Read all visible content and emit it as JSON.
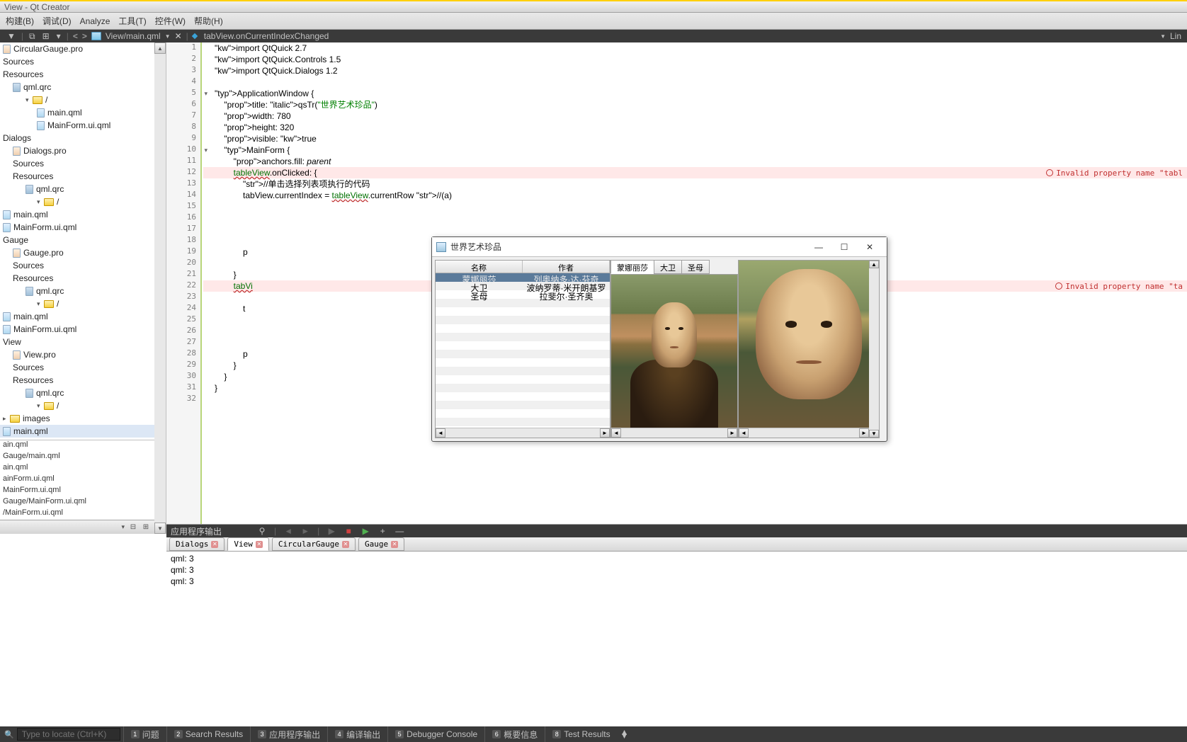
{
  "title_bar": "View - Qt Creator",
  "menu": [
    "构建(B)",
    "调试(D)",
    "Analyze",
    "工具(T)",
    "控件(W)",
    "帮助(H)"
  ],
  "toolbar": {
    "nav": [
      "<",
      ">"
    ],
    "file": "View/main.qml",
    "func": "tabView.onCurrentIndexChanged",
    "right": "Lin"
  },
  "tree": [
    {
      "lvl": 0,
      "type": "pro",
      "label": "CircularGauge.pro"
    },
    {
      "lvl": 0,
      "type": "section",
      "label": "Sources"
    },
    {
      "lvl": 0,
      "type": "section",
      "label": "Resources"
    },
    {
      "lvl": 1,
      "type": "qrc",
      "label": "qml.qrc"
    },
    {
      "lvl": 2,
      "type": "folder",
      "caret": "v",
      "label": "/"
    },
    {
      "lvl": 3,
      "type": "qml",
      "label": "main.qml"
    },
    {
      "lvl": 3,
      "type": "qml",
      "label": "MainForm.ui.qml"
    },
    {
      "lvl": 0,
      "type": "section",
      "label": "Dialogs"
    },
    {
      "lvl": 1,
      "type": "pro",
      "label": "Dialogs.pro"
    },
    {
      "lvl": 1,
      "type": "section",
      "label": "Sources"
    },
    {
      "lvl": 1,
      "type": "section",
      "label": "Resources"
    },
    {
      "lvl": 2,
      "type": "qrc",
      "label": "qml.qrc"
    },
    {
      "lvl": 3,
      "type": "folder",
      "caret": "v",
      "label": "/"
    },
    {
      "lvl": 4,
      "type": "qml",
      "label": "main.qml"
    },
    {
      "lvl": 4,
      "type": "qml",
      "label": "MainForm.ui.qml"
    },
    {
      "lvl": 0,
      "type": "section",
      "label": "Gauge"
    },
    {
      "lvl": 1,
      "type": "pro",
      "label": "Gauge.pro"
    },
    {
      "lvl": 1,
      "type": "section",
      "label": "Sources"
    },
    {
      "lvl": 1,
      "type": "section",
      "label": "Resources"
    },
    {
      "lvl": 2,
      "type": "qrc",
      "label": "qml.qrc"
    },
    {
      "lvl": 3,
      "type": "folder",
      "caret": "v",
      "label": "/"
    },
    {
      "lvl": 4,
      "type": "qml",
      "label": "main.qml"
    },
    {
      "lvl": 4,
      "type": "qml",
      "label": "MainForm.ui.qml"
    },
    {
      "lvl": 0,
      "type": "section",
      "label": "View"
    },
    {
      "lvl": 1,
      "type": "pro",
      "label": "View.pro"
    },
    {
      "lvl": 1,
      "type": "section",
      "label": "Sources"
    },
    {
      "lvl": 1,
      "type": "section",
      "label": "Resources"
    },
    {
      "lvl": 2,
      "type": "qrc",
      "label": "qml.qrc"
    },
    {
      "lvl": 3,
      "type": "folder",
      "caret": "v",
      "label": "/"
    },
    {
      "lvl": 4,
      "type": "folder",
      "caret": ">",
      "label": "images"
    },
    {
      "lvl": 4,
      "type": "qml",
      "label": "main.qml",
      "sel": true
    },
    {
      "lvl": 4,
      "type": "qml",
      "label": "MainForm.ui.qml"
    }
  ],
  "open_docs": [
    "ain.qml",
    "Gauge/main.qml",
    "ain.qml",
    "ainForm.ui.qml",
    "MainForm.ui.qml",
    "Gauge/MainForm.ui.qml",
    "/MainForm.ui.qml"
  ],
  "code": [
    "import QtQuick 2.7",
    "import QtQuick.Controls 1.5",
    "import QtQuick.Dialogs 1.2",
    "",
    "ApplicationWindow {",
    "    title: qsTr(\"世界艺术珍品\")",
    "    width: 780",
    "    height: 320",
    "    visible: true",
    "    MainForm {",
    "        anchors.fill: parent",
    "        tableView.onClicked: {",
    "            //单击选择列表项执行的代码",
    "            tabView.currentIndex = tableView.currentRow //(a)",
    "        ",
    "        ",
    "        ",
    "        ",
    "            p",
    "        ",
    "        }",
    "        tabVi",
    "        ",
    "            t",
    "        ",
    "        ",
    "            ",
    "            p",
    "        }",
    "    }",
    "}",
    ""
  ],
  "inline_errors": [
    {
      "line": 12,
      "text": "Invalid property name \"tabl"
    },
    {
      "line": 22,
      "text": "Invalid property name \"ta"
    }
  ],
  "app": {
    "title": "世界艺术珍品",
    "table": {
      "headers": [
        "名称",
        "作者"
      ],
      "rows": [
        {
          "name": "蒙娜丽莎",
          "author": "列奥纳多·达·芬奇",
          "sel": true
        },
        {
          "name": "大卫",
          "author": "波纳罗蒂·米开朗基罗"
        },
        {
          "name": "圣母",
          "author": "拉斐尔·圣齐奥"
        }
      ]
    },
    "tabs": [
      "蒙娜丽莎",
      "大卫",
      "圣母"
    ]
  },
  "output": {
    "title": "应用程序输出",
    "tabs": [
      {
        "label": "Dialogs",
        "closable": true
      },
      {
        "label": "View",
        "closable": true,
        "active": true
      },
      {
        "label": "CircularGauge",
        "closable": true
      },
      {
        "label": "Gauge",
        "closable": true
      }
    ],
    "lines": [
      "qml: 3",
      "qml: 3",
      "qml: 3"
    ]
  },
  "status": {
    "placeholder": "Type to locate (Ctrl+K)",
    "items": [
      {
        "n": "1",
        "label": "问题"
      },
      {
        "n": "2",
        "label": "Search Results"
      },
      {
        "n": "3",
        "label": "应用程序输出"
      },
      {
        "n": "4",
        "label": "编译输出"
      },
      {
        "n": "5",
        "label": "Debugger Console"
      },
      {
        "n": "6",
        "label": "概要信息"
      },
      {
        "n": "8",
        "label": "Test Results"
      }
    ]
  }
}
